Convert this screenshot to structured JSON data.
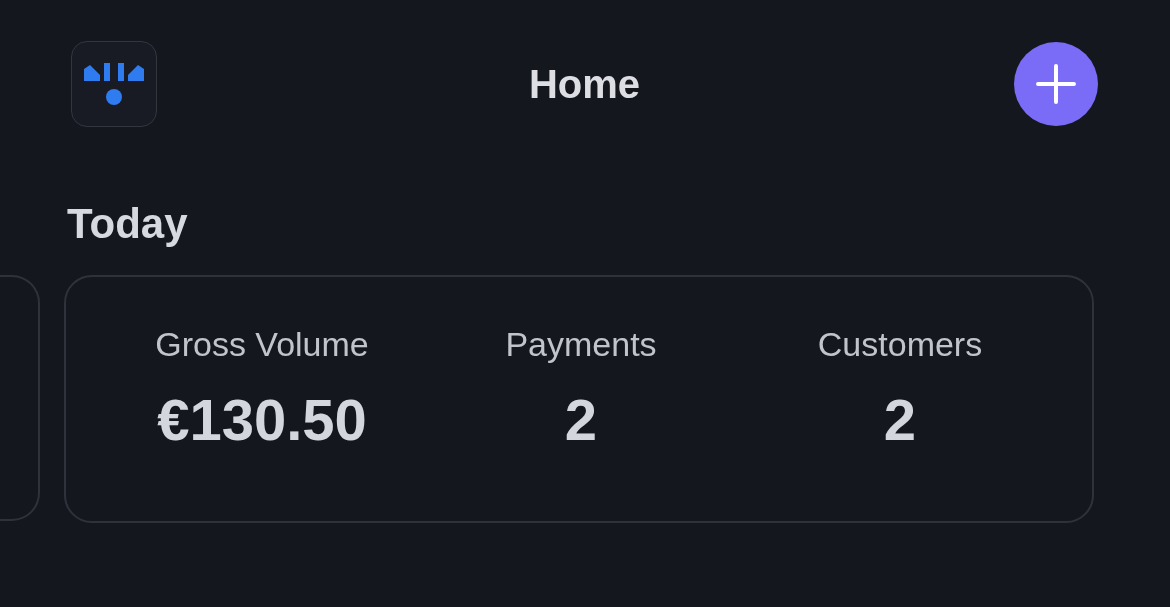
{
  "header": {
    "title": "Home"
  },
  "section": {
    "title": "Today"
  },
  "stats": [
    {
      "label": "Gross Volume",
      "value": "€130.50"
    },
    {
      "label": "Payments",
      "value": "2"
    },
    {
      "label": "Customers",
      "value": "2"
    }
  ]
}
